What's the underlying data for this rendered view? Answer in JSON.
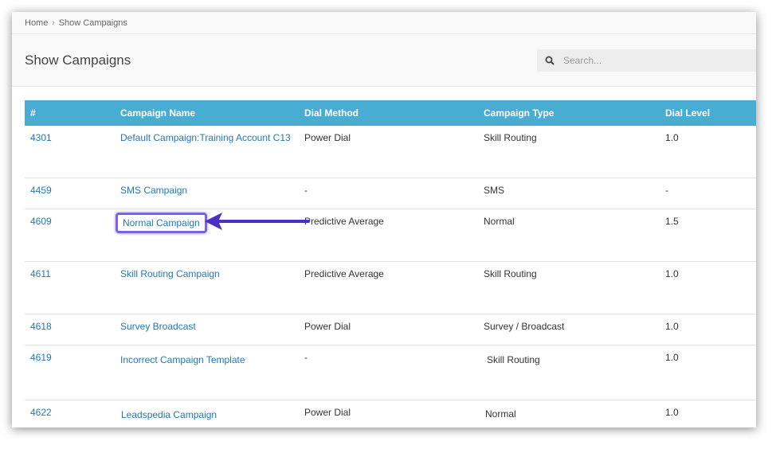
{
  "breadcrumb": {
    "home": "Home",
    "separator": "›",
    "current": "Show Campaigns"
  },
  "page": {
    "title": "Show Campaigns"
  },
  "search": {
    "placeholder": "Search..."
  },
  "table": {
    "headers": [
      "#",
      "Campaign Name",
      "Dial Method",
      "Campaign Type",
      "Dial Level"
    ],
    "rows": [
      {
        "id": "4301",
        "name": "Default Campaign:Training Account C13",
        "dial_method": "Power Dial",
        "type": "Skill Routing",
        "dial_level": "1.0"
      },
      {
        "id": "4459",
        "name": "SMS Campaign",
        "dial_method": "-",
        "type": "SMS",
        "dial_level": "-"
      },
      {
        "id": "4609",
        "name": "Normal Campaign",
        "dial_method": "Predictive Average",
        "type": "Normal",
        "dial_level": "1.5"
      },
      {
        "id": "4611",
        "name": "Skill Routing Campaign",
        "dial_method": "Predictive Average",
        "type": "Skill Routing",
        "dial_level": "1.0"
      },
      {
        "id": "4618",
        "name": "Survey Broadcast",
        "dial_method": "Power Dial",
        "type": "Survey / Broadcast",
        "dial_level": "1.0"
      },
      {
        "id": "4619",
        "name": "Incorrect Campaign Template",
        "dial_method": "-",
        "type": "Skill Routing",
        "dial_level": "1.0"
      },
      {
        "id": "4622",
        "name": "Leadspedia Campaign",
        "dial_method": "Power Dial",
        "type": "Normal",
        "dial_level": "1.0"
      }
    ]
  },
  "annotation": {
    "highlight_color": "#7a5ff0",
    "arrow_color": "#4b2fc7"
  },
  "colors": {
    "header_bg": "#49acd2",
    "link": "#2277b6"
  }
}
